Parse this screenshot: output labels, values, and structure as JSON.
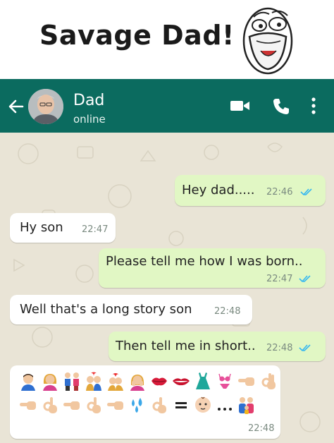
{
  "meme": {
    "title": "Savage Dad!"
  },
  "header": {
    "contact_name": "Dad",
    "status": "online",
    "colors": {
      "app_bar": "#0b6b5f",
      "outgoing_bubble": "#e1f7c4",
      "incoming_bubble": "#ffffff",
      "tick_blue": "#34b7f1"
    }
  },
  "messages": [
    {
      "direction": "out",
      "text": "Hey dad.....",
      "time": "22:46",
      "read": true
    },
    {
      "direction": "in",
      "text": "Hy son",
      "time": "22:47"
    },
    {
      "direction": "out",
      "text": "Please tell me how I was born..",
      "time": "22:47",
      "read": true
    },
    {
      "direction": "in",
      "text": "Well that's a long story son",
      "time": "22:48"
    },
    {
      "direction": "out",
      "text": "Then tell me in short..",
      "time": "22:48",
      "read": true
    },
    {
      "direction": "in",
      "time": "22:48",
      "emoji_line_1": [
        "man",
        "woman",
        "couple-holding-hands",
        "couple-with-heart",
        "kiss",
        "woman-hands-on-face",
        "lips",
        "mouth",
        "dress",
        "bikini",
        "pointing-left",
        "ok-hand"
      ],
      "emoji_line_2": [
        "pointing-left",
        "ok-hand",
        "pointing-left",
        "ok-hand",
        "pointing-left",
        "sweat-droplets",
        "ok-hand",
        "equals",
        "baby",
        "ellipsis",
        "family"
      ]
    }
  ]
}
